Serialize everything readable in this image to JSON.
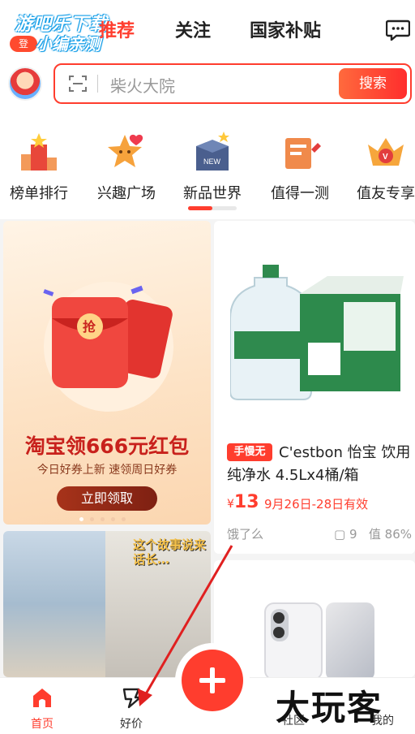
{
  "watermark": {
    "line1": "游吧乐下载",
    "line2": "小编亲测",
    "login": "登"
  },
  "top_tabs": [
    {
      "label": "推荐",
      "active": true
    },
    {
      "label": "关注",
      "active": false
    },
    {
      "label": "国家补贴",
      "active": false
    }
  ],
  "search": {
    "placeholder": "柴火大院",
    "button": "搜索"
  },
  "categories": [
    {
      "label": "榜单排行",
      "icon": "podium-icon"
    },
    {
      "label": "兴趣广场",
      "icon": "star-heart-icon"
    },
    {
      "label": "新品世界",
      "icon": "new-box-icon"
    },
    {
      "label": "值得一测",
      "icon": "test-pencil-icon"
    },
    {
      "label": "值友专享",
      "icon": "vip-crown-icon"
    }
  ],
  "promo": {
    "title": "淘宝领666元红包",
    "subtitle": "今日好券上新 速领周日好券",
    "button": "立即领取",
    "ribbon_char": "抢"
  },
  "product": {
    "badge": "手慢无",
    "name": "C'estbon 怡宝 饮用纯净水 4.5Lx4桶/箱",
    "currency": "¥",
    "price": "13",
    "promo_date": "9月26日-28日有效",
    "source": "饿了么",
    "comments": "9",
    "worth_rate": "86%"
  },
  "photo_card": {
    "caption": "这个故事说来话长…"
  },
  "bottom_nav": [
    {
      "label": "首页",
      "active": true,
      "icon": "home-icon"
    },
    {
      "label": "好价",
      "active": false,
      "icon": "deal-icon"
    },
    {
      "label": "社区",
      "active": false,
      "icon": "community-icon"
    },
    {
      "label": "我的",
      "active": false,
      "icon": "profile-icon"
    }
  ],
  "brandmark": "大玩客",
  "colors": {
    "accent": "#ff3d2e",
    "annotation_arrow": "#e02020"
  }
}
